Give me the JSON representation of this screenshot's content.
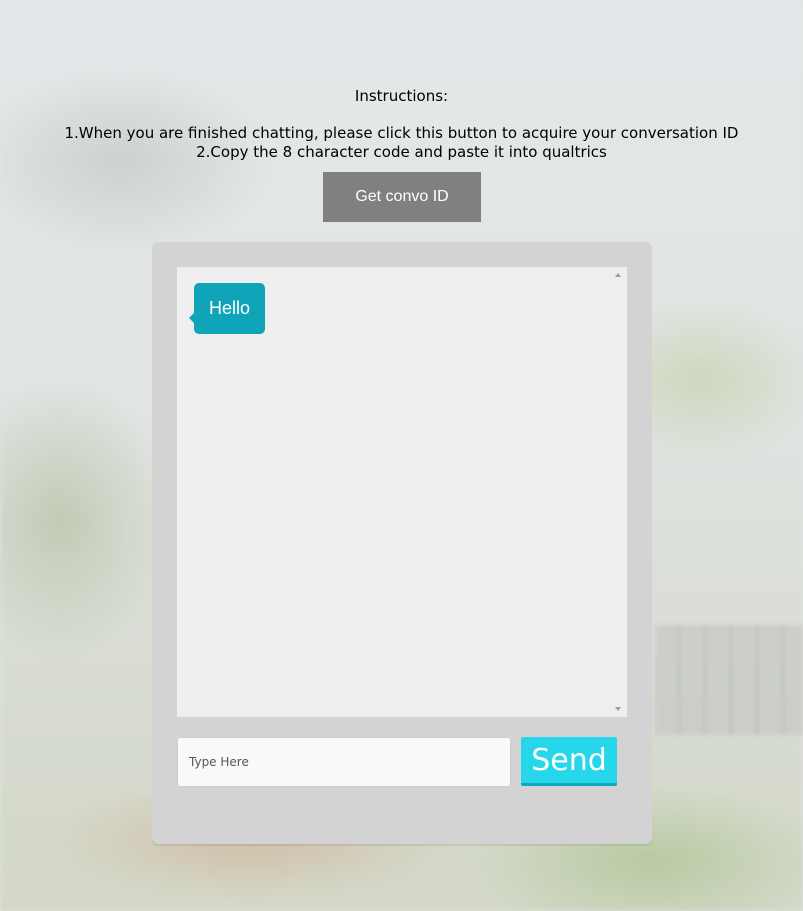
{
  "instructions": {
    "title": "Instructions:",
    "step1": "1.When you are finished chatting, please click this button to acquire your conversation ID",
    "step2": "2.Copy the 8 character code and paste it into qualtrics"
  },
  "convo_button": {
    "label": "Get convo ID"
  },
  "chat": {
    "messages": [
      {
        "text": "Hello"
      }
    ],
    "input": {
      "value": "",
      "placeholder": "Type Here"
    },
    "send_label": "Send"
  },
  "colors": {
    "bubble": "#0fa4b7",
    "send": "#26d7ec",
    "convo_button": "#808080",
    "panel": "#d3d3d3"
  }
}
